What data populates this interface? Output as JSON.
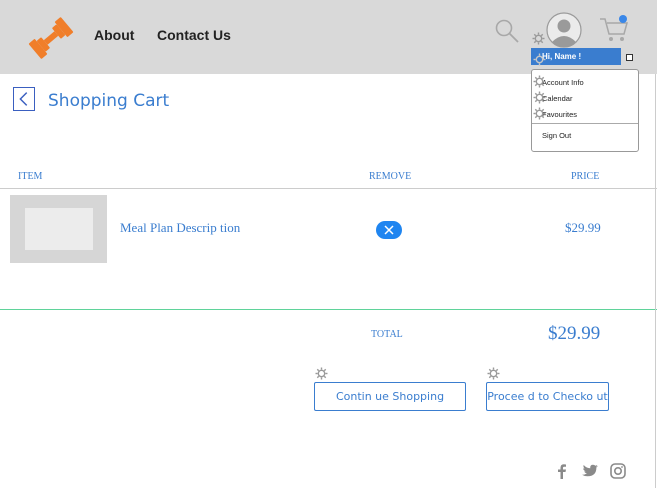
{
  "header": {
    "nav": [
      {
        "label": "About"
      },
      {
        "label": "Contact Us"
      }
    ],
    "cart_badge_color": "#3a87e8"
  },
  "user_menu": {
    "greeting": "Hi, Name !",
    "items": [
      {
        "label": "Account Info"
      },
      {
        "label": "Calendar"
      },
      {
        "label": "Favourites"
      }
    ],
    "sign_out": "Sign Out"
  },
  "page": {
    "title": "Shopping Cart"
  },
  "cart": {
    "columns": {
      "item": "ITEM",
      "remove": "REMOVE",
      "price": "PRICE"
    },
    "rows": [
      {
        "description": "Meal Plan Descrip tion",
        "price": "$29.99"
      }
    ],
    "total_label": "TOTAL",
    "total_value": "$29.99"
  },
  "actions": {
    "continue_label": "Contin ue Shopping",
    "checkout_label": "Procee d to Checko ut"
  },
  "colors": {
    "header_bg": "#d9d9d9",
    "accent": "#3a7dcf",
    "logo_orange": "#f07e2a",
    "remove_blue": "#1f85f0",
    "divider_green": "#5fd39a"
  }
}
